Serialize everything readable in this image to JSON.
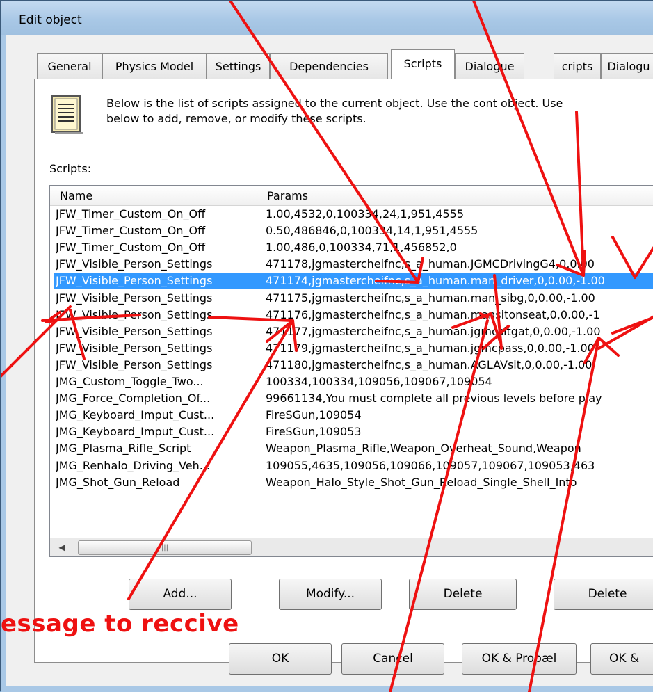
{
  "window": {
    "title": "Edit object"
  },
  "tabs": [
    {
      "label": "General"
    },
    {
      "label": "Physics Model"
    },
    {
      "label": "Settings"
    },
    {
      "label": "Dependencies"
    },
    {
      "label": "Scripts"
    },
    {
      "label": "Dialogue"
    },
    {
      "label": "cripts"
    },
    {
      "label": "Dialogu"
    }
  ],
  "active_tab": "Scripts",
  "description": {
    "line1": "Below is the list of scripts assigned to the current object.  Use the cont object.  Use",
    "line2": "below to add, remove, or modify these scripts."
  },
  "scripts_label": "Scripts:",
  "list": {
    "columns": [
      "Name",
      "Params"
    ],
    "rows": [
      {
        "name": "JFW_Timer_Custom_On_Off",
        "params": "1.00,4532,0,100334,24,1,951,4555"
      },
      {
        "name": "JFW_Timer_Custom_On_Off",
        "params": "0.50,486846,0,100334,14,1,951,4555"
      },
      {
        "name": "JFW_Timer_Custom_On_Off",
        "params": "1.00,486,0,100334,71,1,456852,0"
      },
      {
        "name": "JFW_Visible_Person_Settings",
        "params": "471178,jgmastercheifnc,s_a_human.JGMCDrivingG4,0,0.00"
      },
      {
        "name": "JFW_Visible_Person_Settings",
        "params": "471174,jgmastercheifnc,s_a_human.man_driver,0,0.00,-1.00",
        "selected": true
      },
      {
        "name": "JFW_Visible_Person_Settings",
        "params": "471175,jgmastercheifnc,s_a_human.man_sibg,0,0.00,-1.00"
      },
      {
        "name": "JFW_Visible_Person_Settings",
        "params": "471176,jgmastercheifnc,s_a_human.mansitonseat,0,0.00,-1"
      },
      {
        "name": "JFW_Visible_Person_Settings",
        "params": "471177,jgmastercheifnc,s_a_human.jgmcsitgat,0,0.00,-1.00"
      },
      {
        "name": "JFW_Visible_Person_Settings",
        "params": "471179,jgmastercheifnc,s_a_human.jgmcpass,0,0.00,-1.00,"
      },
      {
        "name": "JFW_Visible_Person_Settings",
        "params": "471180,jgmastercheifnc,s_a_human.AGLAVsit,0,0.00,-1.00"
      },
      {
        "name": "JMG_Custom_Toggle_Two...",
        "params": "100334,100334,109056,109067,109054"
      },
      {
        "name": "JMG_Force_Completion_Of...",
        "params": "99661134,You must complete all previous levels before play"
      },
      {
        "name": "JMG_Keyboard_Imput_Cust...",
        "params": "FireSGun,109054"
      },
      {
        "name": "JMG_Keyboard_Imput_Cust...",
        "params": "FireSGun,109053"
      },
      {
        "name": "JMG_Plasma_Rifle_Script",
        "params": "Weapon_Plasma_Rifle,Weapon_Overheat_Sound,Weapon"
      },
      {
        "name": "JMG_Renhalo_Driving_Veh...",
        "params": "109055,4635,109056,109066,109057,109067,109053,463"
      },
      {
        "name": "JMG_Shot_Gun_Reload",
        "params": "Weapon_Halo_Style_Shot_Gun_Reload_Single_Shell_Into"
      }
    ]
  },
  "scrollbar": {
    "left_arrow": "◀",
    "grip": "|||"
  },
  "buttons": {
    "add": "Add...",
    "modify": "Modify...",
    "delete": "Delete",
    "delete2": "Delete",
    "ok": "OK",
    "cancel": "Cancel",
    "ok_propagate": "OK & Propæl",
    "ok2": "OK &"
  },
  "annotation": {
    "text": "essage to reccive",
    "color": "#ee1111"
  }
}
